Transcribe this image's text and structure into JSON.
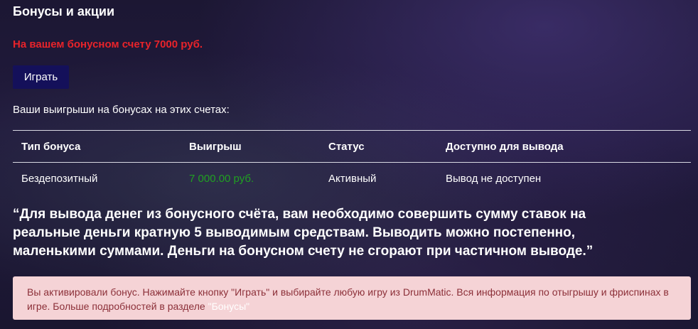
{
  "page": {
    "title": "Бонусы и акции",
    "bonus_balance_text": "На вашем бонусном счету 7000 руб.",
    "play_button_label": "Играть",
    "winnings_label": "Ваши выигрыши на бонусах на этих счетах:"
  },
  "table": {
    "headers": [
      "Тип бонуса",
      "Выигрыш",
      "Статус",
      "Доступно для вывода"
    ],
    "rows": [
      [
        "Бездепозитный",
        "7 000.00 руб.",
        "Активный",
        "Вывод не доступен"
      ]
    ]
  },
  "quote": "“Для вывода денег из бонусного счёта, вам необходимо совершить сумму ставок на реальные деньги кратную 5 выводимым средствам. Выводить можно постепенно, маленькими суммами. Деньги на бонусном счету не сгорают при частичном выводе.”",
  "notice": {
    "text": "Вы активировали бонус. Нажимайте кнопку \"Играть\" и выбирайте любую игру из DrumMatic. Вся информация по отыгрышу и фриспинах в игре. Больше подробностей в разделе ",
    "link_text": "\"Бонусы\""
  },
  "colors": {
    "accent_red": "#e8232a",
    "button_bg": "#14105a",
    "win_green": "#20a022",
    "notice_bg": "#f5d3d6"
  }
}
